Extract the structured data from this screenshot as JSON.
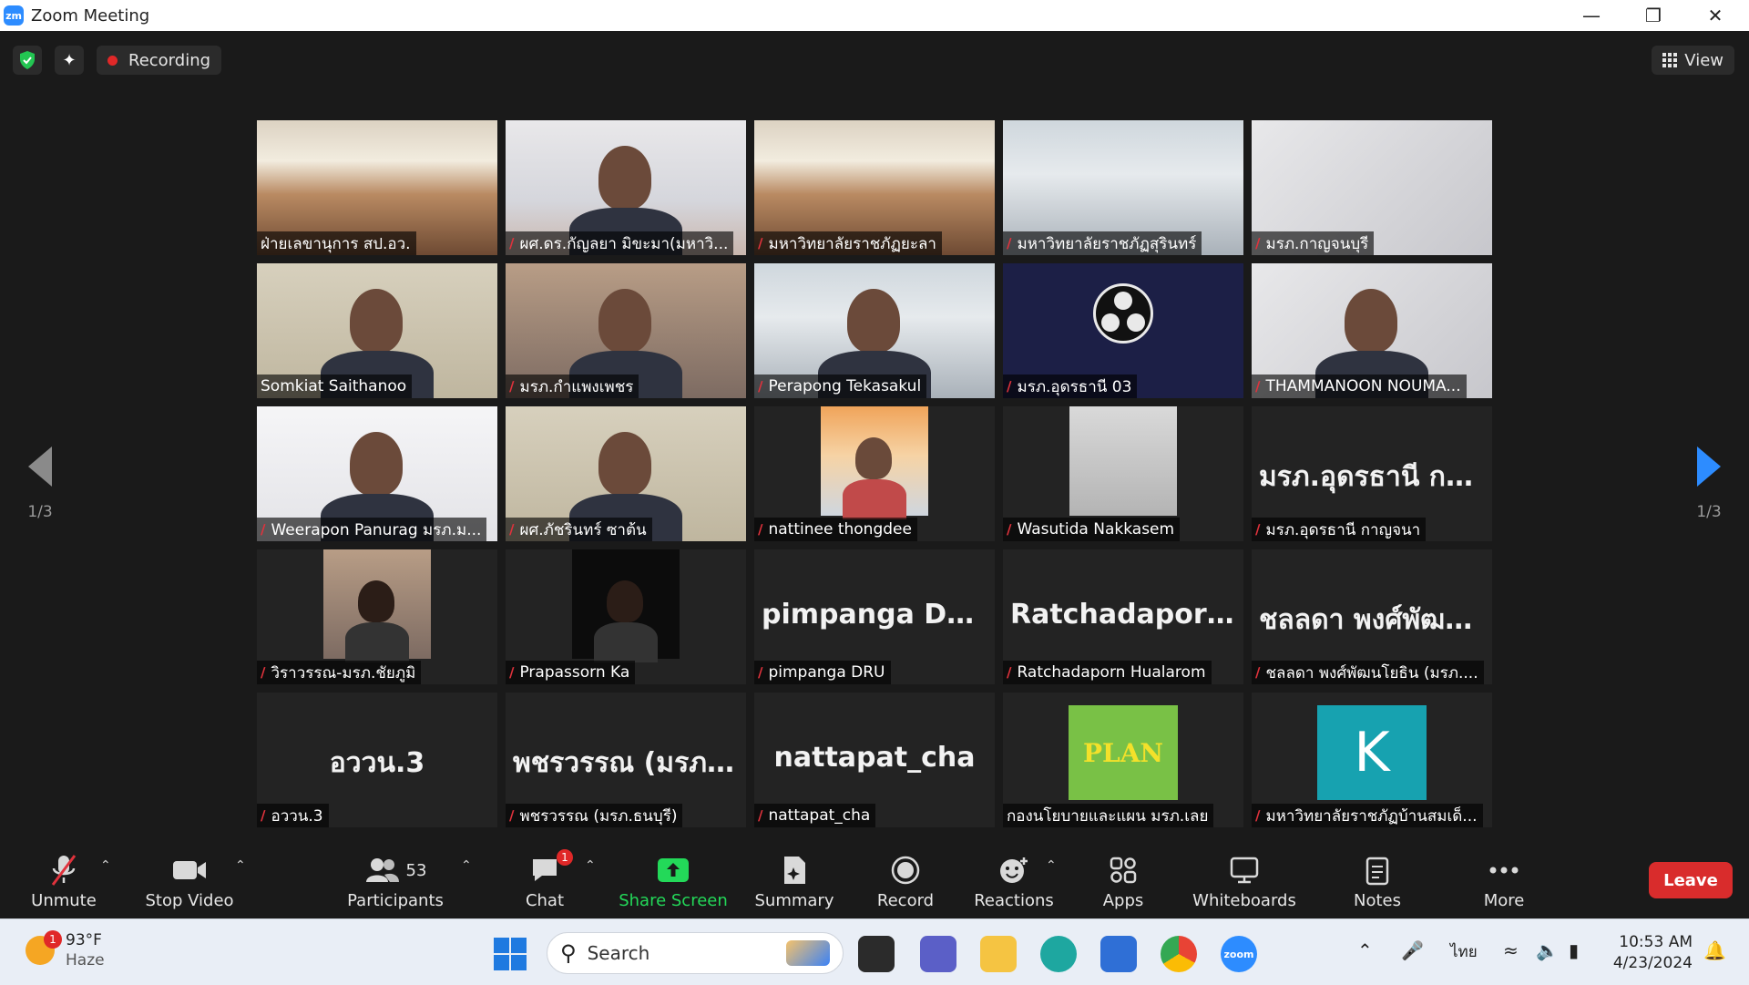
{
  "window": {
    "app_icon": "zm",
    "title": "Zoom Meeting",
    "controls": [
      "minimize-icon",
      "restore-icon",
      "close-icon"
    ]
  },
  "topbar": {
    "recording_label": "Recording",
    "view_label": "View"
  },
  "pager": {
    "left": "1/3",
    "right": "1/3"
  },
  "tiles": [
    {
      "name": "ฝ่ายเลขานุการ สป.อว.",
      "muted": false,
      "kind": "room"
    },
    {
      "name": "ผศ.ดร.กัญลยา มิขะมา(มหาวิ...",
      "muted": true,
      "kind": "office"
    },
    {
      "name": "มหาวิทยาลัยราชภัฏยะลา",
      "muted": true,
      "kind": "room"
    },
    {
      "name": "มหาวิทยาลัยราชภัฏสุรินทร์",
      "muted": true,
      "kind": "hall"
    },
    {
      "name": "มรภ.กาญจนบุรี",
      "muted": true,
      "kind": "wall"
    },
    {
      "name": "Somkiat Saithanoo",
      "muted": false,
      "kind": "beige"
    },
    {
      "name": "มรภ.กำแพงเพชร",
      "muted": true,
      "kind": "pinkish"
    },
    {
      "name": "Perapong Tekasakul",
      "muted": true,
      "kind": "hall",
      "active": true
    },
    {
      "name": "มรภ.อุดรธานี 03",
      "muted": true,
      "kind": "obs"
    },
    {
      "name": "THAMMANOON NOUMA...",
      "muted": true,
      "kind": "wall"
    },
    {
      "name": "Weerapon Panurag มรภ.ม...",
      "muted": true,
      "kind": "bright"
    },
    {
      "name": "ผศ.ภัชรินทร์ ซาต้น",
      "muted": true,
      "kind": "beige"
    },
    {
      "name": "nattinee thongdee",
      "muted": true,
      "kind": "bridge"
    },
    {
      "name": "Wasutida Nakkasem",
      "muted": true,
      "kind": "corr"
    },
    {
      "name": "มรภ.อุดรธานี กาญจนา",
      "muted": true,
      "kind": "text",
      "display": "มรภ.อุดรธานี กา..."
    },
    {
      "name": "วิราวรรณ-มรภ.ชัยภูมิ",
      "muted": true,
      "kind": "photo"
    },
    {
      "name": "Prapassorn Ka",
      "muted": true,
      "kind": "darkphoto"
    },
    {
      "name": "pimpanga DRU",
      "muted": true,
      "kind": "text",
      "display": "pimpanga DRU"
    },
    {
      "name": "Ratchadaporn Hualarom",
      "muted": true,
      "kind": "text",
      "display": "Ratchadaporn..."
    },
    {
      "name": "ชลลดา พงศ์พัฒนโยธิน (มรภ....",
      "muted": true,
      "kind": "text",
      "display": "ชลลดา พงศ์พัฒน..."
    },
    {
      "name": "อววน.3",
      "muted": true,
      "kind": "text",
      "display": "อววน.3"
    },
    {
      "name": "พชรวรรณ (มรภ.ธนบุรี)",
      "muted": true,
      "kind": "text",
      "display": "พชรวรรณ (มรภ...."
    },
    {
      "name": "nattapat_cha",
      "muted": true,
      "kind": "text",
      "display": "nattapat_cha"
    },
    {
      "name": "กองนโยบายและแผน มรภ.เลย",
      "muted": false,
      "kind": "plan",
      "display": "PLAN"
    },
    {
      "name": "มหาวิทยาลัยราชภัฏบ้านสมเด็...",
      "muted": true,
      "kind": "avatar",
      "display": "K"
    }
  ],
  "toolbar": {
    "unmute": "Unmute",
    "stop_video": "Stop Video",
    "participants": "Participants",
    "participants_count": "53",
    "chat": "Chat",
    "chat_badge": "1",
    "share_screen": "Share Screen",
    "summary": "Summary",
    "record": "Record",
    "reactions": "Reactions",
    "apps": "Apps",
    "whiteboards": "Whiteboards",
    "notes": "Notes",
    "more": "More",
    "leave": "Leave"
  },
  "taskbar": {
    "weather_temp": "93°F",
    "weather_desc": "Haze",
    "weather_badge": "1",
    "search_placeholder": "Search",
    "language": "ไทย",
    "time": "10:53 AM",
    "date": "4/23/2024",
    "apps": [
      "task-view-icon",
      "meet-icon",
      "file-explorer-icon",
      "edge-icon",
      "store-icon",
      "chrome-icon",
      "zoom-icon"
    ]
  },
  "colors": {
    "active_speaker": "#b8e23a",
    "share_green": "#23d959",
    "leave_red": "#d92c2c",
    "zoom_blue": "#2d8cff"
  }
}
